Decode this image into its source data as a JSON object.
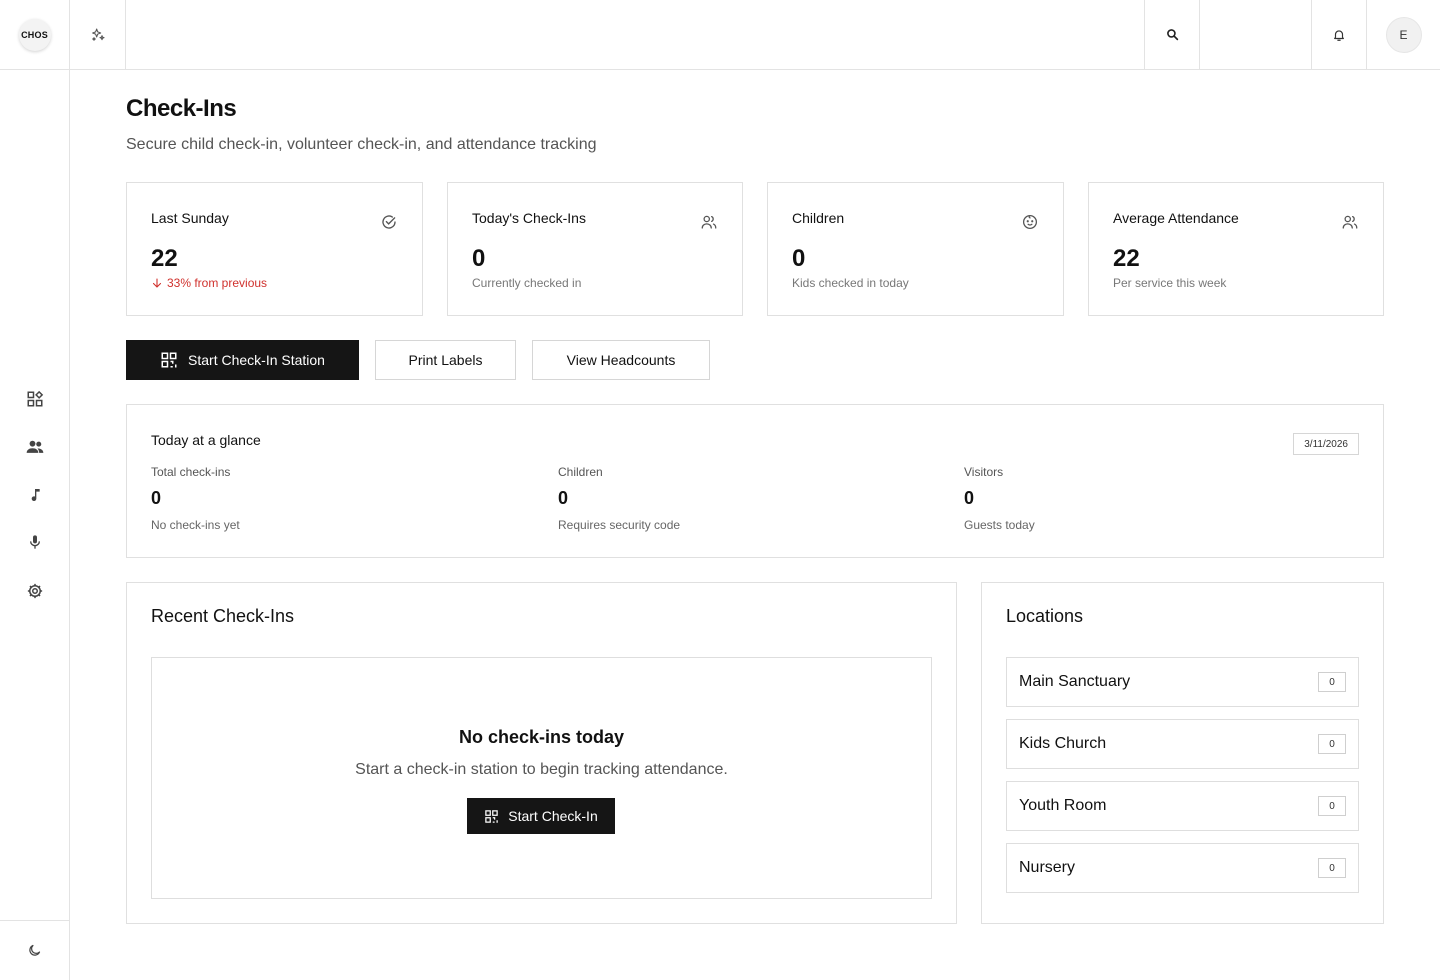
{
  "header": {
    "logo_text": "CHOS",
    "avatar_initial": "E"
  },
  "page": {
    "title": "Check-Ins",
    "subtitle": "Secure child check-in, volunteer check-in, and attendance tracking"
  },
  "stats": [
    {
      "label": "Last Sunday",
      "value": "22",
      "sub": "33% from previous",
      "icon": "check-circle-icon"
    },
    {
      "label": "Today's Check-Ins",
      "value": "0",
      "sub": "Currently checked in",
      "icon": "users-icon"
    },
    {
      "label": "Children",
      "value": "0",
      "sub": "Kids checked in today",
      "icon": "baby-icon"
    },
    {
      "label": "Average Attendance",
      "value": "22",
      "sub": "Per service this week",
      "icon": "users-icon"
    }
  ],
  "actions": {
    "start_station": "Start Check-In Station",
    "print_labels": "Print Labels",
    "view_headcounts": "View Headcounts"
  },
  "glance": {
    "title": "Today at a glance",
    "date": "3/11/2026",
    "columns": [
      {
        "label": "Total check-ins",
        "value": "0",
        "sub": "No check-ins yet"
      },
      {
        "label": "Children",
        "value": "0",
        "sub": "Requires security code"
      },
      {
        "label": "Visitors",
        "value": "0",
        "sub": "Guests today"
      }
    ]
  },
  "recent": {
    "title": "Recent Check-Ins",
    "empty_title": "No check-ins today",
    "empty_sub": "Start a check-in station to begin tracking attendance.",
    "empty_button": "Start Check-In"
  },
  "locations": {
    "title": "Locations",
    "items": [
      {
        "name": "Main Sanctuary",
        "count": "0"
      },
      {
        "name": "Kids Church",
        "count": "0"
      },
      {
        "name": "Youth Room",
        "count": "0"
      },
      {
        "name": "Nursery",
        "count": "0"
      }
    ]
  },
  "colors": {
    "primary_button": "#151515",
    "negative": "#d0312d",
    "border": "#e0e0e0"
  }
}
